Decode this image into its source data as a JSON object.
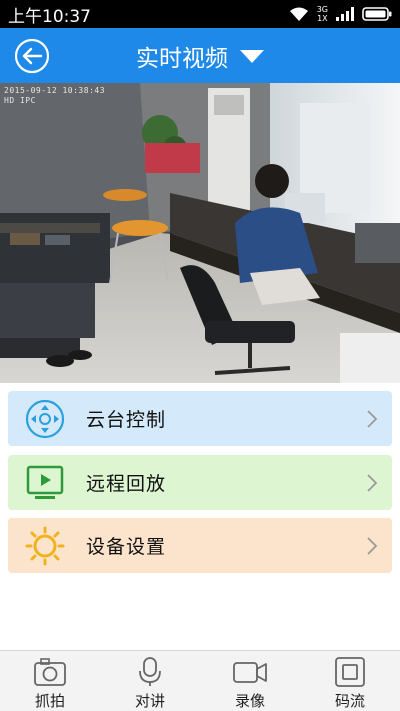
{
  "status_bar": {
    "time": "上午10:37",
    "network_label_top": "3G",
    "network_label_bottom": "1X"
  },
  "header": {
    "title": "实时视频"
  },
  "video": {
    "osd_timestamp": "2015-09-12 10:38:43",
    "osd_channel": "HD IPC"
  },
  "menu": [
    {
      "label": "云台控制",
      "bg": "#D4E9F9",
      "icon": "ptz-dpad-icon"
    },
    {
      "label": "远程回放",
      "bg": "#DEF5D2",
      "icon": "playback-screen-icon"
    },
    {
      "label": "设备设置",
      "bg": "#FCE3CC",
      "icon": "settings-sun-icon"
    }
  ],
  "tabs": [
    {
      "label": "抓拍",
      "icon": "camera-icon"
    },
    {
      "label": "对讲",
      "icon": "microphone-icon"
    },
    {
      "label": "录像",
      "icon": "video-record-icon"
    },
    {
      "label": "码流",
      "icon": "stream-icon"
    }
  ],
  "colors": {
    "accent": "#1E89E8",
    "status_bar": "#000000",
    "bottom_bar": "#F3F3F3"
  }
}
